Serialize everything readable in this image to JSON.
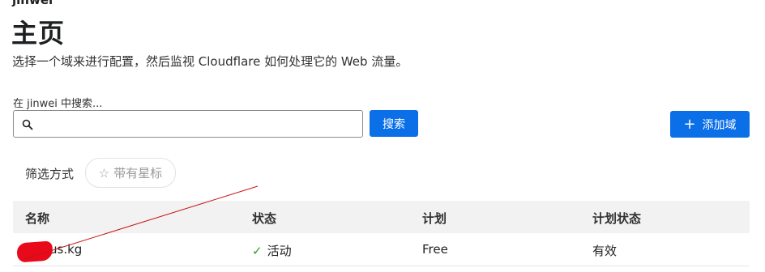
{
  "header": {
    "account": "jinwei",
    "title": "主页",
    "subtitle": "选择一个域来进行配置，然后监视 Cloudflare 如何处理它的 Web 流量。"
  },
  "search": {
    "label": "在 jinwei 中搜索...",
    "value": "",
    "placeholder": "",
    "button_label": "搜索"
  },
  "actions": {
    "add_domain_label": "添加域"
  },
  "filter": {
    "label": "筛选方式",
    "starred_label": "带有星标"
  },
  "table": {
    "headers": [
      "名称",
      "状态",
      "计划",
      "计划状态"
    ],
    "rows": [
      {
        "name": "us.kg",
        "status": "活动",
        "plan": "Free",
        "plan_status": "有效"
      }
    ]
  },
  "colors": {
    "accent": "#0b6fe8",
    "status_ok": "#2c9f2c",
    "annotation": "#e8091a"
  },
  "icons": [
    "search-icon",
    "plus-icon",
    "star-outline-icon",
    "check-icon"
  ]
}
